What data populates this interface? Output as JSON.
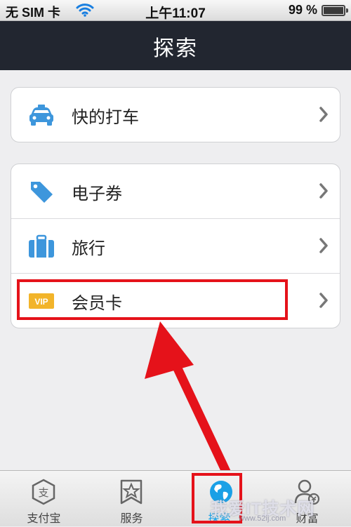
{
  "status_bar": {
    "carrier": "无 SIM 卡",
    "time": "上午11:07",
    "battery": "99 %",
    "battery_level": 0.99
  },
  "nav": {
    "title": "探索"
  },
  "groups": [
    {
      "rows": [
        {
          "label": "快的打车",
          "icon": "taxi-icon"
        }
      ]
    },
    {
      "rows": [
        {
          "label": "电子券",
          "icon": "coupon-tag-icon"
        },
        {
          "label": "旅行",
          "icon": "luggage-icon"
        },
        {
          "label": "会员卡",
          "icon": "vip-card-icon",
          "icon_text": "VIP"
        }
      ]
    }
  ],
  "tabs": [
    {
      "label": "支付宝",
      "icon": "alipay-icon"
    },
    {
      "label": "服务",
      "icon": "star-icon"
    },
    {
      "label": "探索",
      "icon": "globe-icon",
      "active": true
    },
    {
      "label": "财富",
      "icon": "wealth-icon"
    }
  ],
  "watermark": {
    "main": "我爱IT技术网",
    "sub": "www.52ij.com"
  },
  "colors": {
    "accent": "#1aa0e6",
    "annotation": "#e5121a",
    "navbar": "#222630",
    "vip": "#f2b42a"
  }
}
